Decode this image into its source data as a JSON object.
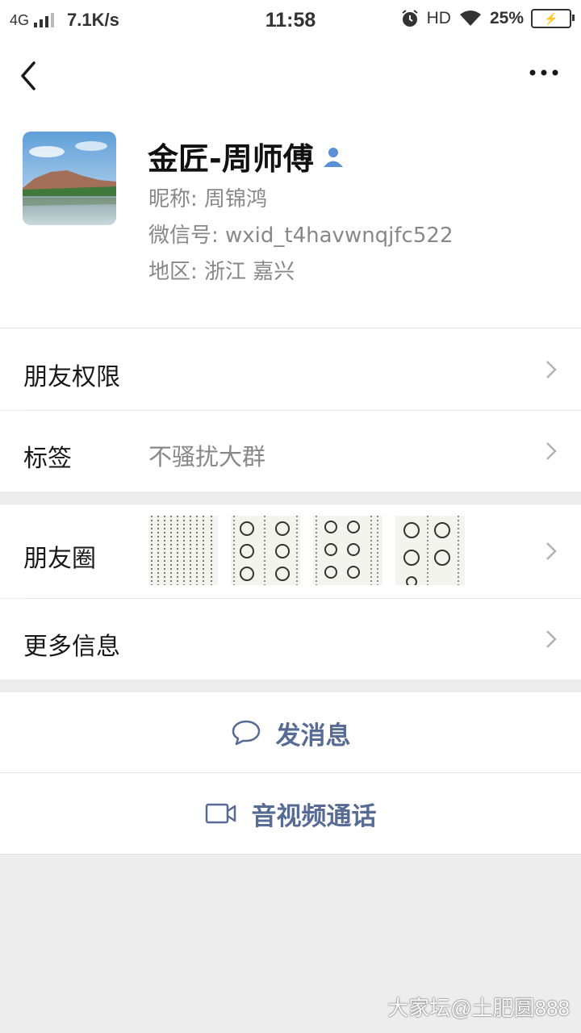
{
  "status_bar": {
    "network": "4G",
    "speed": "7.1K/s",
    "time": "11:58",
    "hd": "HD",
    "battery": "25%"
  },
  "profile": {
    "name": "金匠-周师傅",
    "nickname": "昵称: 周锦鸿",
    "wechat_id": "微信号: wxid_t4havwnqjfc522",
    "region": "地区: 浙江  嘉兴"
  },
  "rows": {
    "permissions_label": "朋友权限",
    "tags_label": "标签",
    "tags_value": "不骚扰大群",
    "moments_label": "朋友圈",
    "more_info_label": "更多信息"
  },
  "actions": {
    "message": "发消息",
    "call": "音视频通话"
  },
  "watermark": "大家坛@土肥圆888",
  "colors": {
    "link_blue": "#576b95",
    "background": "#ededed"
  }
}
